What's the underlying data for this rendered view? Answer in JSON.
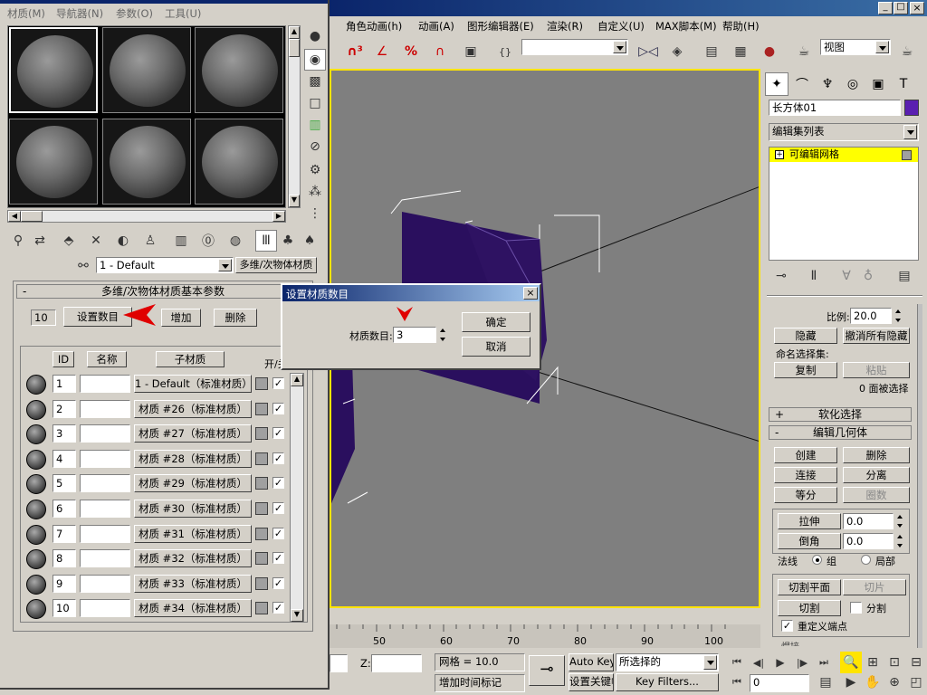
{
  "menubar": {
    "items": [
      "角色动画(h)",
      "动画(A)",
      "图形编辑器(E)",
      "渲染(R)",
      "自定义(U)",
      "MAX脚本(M)",
      "帮助(H)"
    ],
    "window_controls": [
      "_",
      "□",
      "×"
    ]
  },
  "toolbar": {
    "view_dropdown": "视图",
    "selection_dropdown": ""
  },
  "material_editor": {
    "menu": [
      "材质(M)",
      "导航器(N)",
      "参数(O)",
      "工具(U)"
    ],
    "current_material": "1 - Default",
    "material_type_button": "多维/次物体材质",
    "rollout_title": "多维/次物体材质基本参数",
    "count_value": "10",
    "set_count_button": "设置数目",
    "add_button": "增加",
    "delete_button": "删除",
    "col_id": "ID",
    "col_name": "名称",
    "col_submaterial": "子材质",
    "col_onoff": "开/关",
    "rows": [
      {
        "id": "1",
        "sub": "1 - Default（标准材质）"
      },
      {
        "id": "2",
        "sub": "材质 #26（标准材质）"
      },
      {
        "id": "3",
        "sub": "材质 #27（标准材质）"
      },
      {
        "id": "4",
        "sub": "材质 #28（标准材质）"
      },
      {
        "id": "5",
        "sub": "材质 #29（标准材质）"
      },
      {
        "id": "6",
        "sub": "材质 #30（标准材质）"
      },
      {
        "id": "7",
        "sub": "材质 #31（标准材质）"
      },
      {
        "id": "8",
        "sub": "材质 #32（标准材质）"
      },
      {
        "id": "9",
        "sub": "材质 #33（标准材质）"
      },
      {
        "id": "10",
        "sub": "材质 #34（标准材质）"
      }
    ],
    "checkmark": "✓"
  },
  "dialog": {
    "title": "设置材质数目",
    "label": "材质数目:",
    "value": "3",
    "ok": "确定",
    "cancel": "取消",
    "close": "×"
  },
  "command_panel": {
    "object_name": "长方体01",
    "object_color": "#5a1fb0",
    "modifier_list": "编辑集列表",
    "stack_item": "可编辑网格",
    "scale_label": "比例:",
    "scale_value": "20.0",
    "hide_button": "隐藏",
    "unhide_all_button": "撤消所有隐藏",
    "named_selection_label": "命名选择集:",
    "copy_button": "复制",
    "paste_button": "粘贴",
    "selected_status": "0 面被选择",
    "soft_selection": "软化选择",
    "soft_sign": "+",
    "edit_geometry": "编辑几何体",
    "edit_sign": "-",
    "create": "创建",
    "delete": "删除",
    "attach": "连接",
    "detach": "分离",
    "divide": "等分",
    "turn": "圈数",
    "extrude": "拉伸",
    "extrude_value": "0.0",
    "bevel": "倒角",
    "bevel_value": "0.0",
    "normal_label": "法线",
    "group_option": "组",
    "local_option": "局部",
    "slice_plane": "切割平面",
    "slice": "切片",
    "cut": "切割",
    "split": "分割",
    "refine_ends": "重定义端点",
    "bottom_text": "焊接"
  },
  "timeline": {
    "ticks": [
      "50",
      "60",
      "70",
      "80",
      "90",
      "100"
    ]
  },
  "status": {
    "z_label": "Z:",
    "grid": "网格 = 10.0",
    "add_time_tag": "增加时间标记",
    "auto_key": "Auto Key",
    "set_key": "设置关键帧",
    "key_mode": "所选择的",
    "key_filters": "Key Filters...",
    "frame_value": "0"
  },
  "colors": {
    "viewport": "#7f7f7f",
    "object": "#2a0f5e",
    "stack_highlight": "#ffff00",
    "arrow_red": "#e00000",
    "title_blue": "#0a246a"
  }
}
